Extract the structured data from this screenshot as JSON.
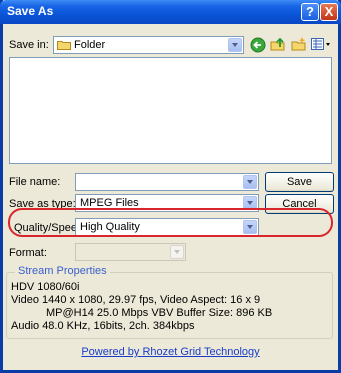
{
  "window": {
    "title": "Save As"
  },
  "title_buttons": {
    "help": "?",
    "close": "X"
  },
  "save_in": {
    "label": "Save in:",
    "value": "Folder"
  },
  "file_name": {
    "label": "File name:",
    "value": "",
    "button": "Save"
  },
  "save_as_type": {
    "label": "Save as type:",
    "value": "MPEG Files",
    "button": "Cancel"
  },
  "quality": {
    "label": "Quality/Speed:",
    "value": "High Quality"
  },
  "format": {
    "label": "Format:",
    "value": ""
  },
  "stream": {
    "title": "Stream Properties",
    "line1": "HDV 1080/60i",
    "line2": "Video 1440 x 1080, 29.97 fps, Video Aspect:  16 x 9",
    "line3": "MP@H14 25.0 Mbps VBV Buffer Size: 896 KB",
    "line4": "Audio 48.0 KHz, 16bits, 2ch. 384kbps"
  },
  "link": "Powered by Rhozet Grid Technology",
  "colors": {
    "highlight": "#d9262c",
    "title_bar": "#0a54d8",
    "link": "#1a3dc9"
  },
  "icons": [
    "folder-icon",
    "back-icon",
    "up-folder-icon",
    "new-folder-icon",
    "views-menu-icon"
  ]
}
